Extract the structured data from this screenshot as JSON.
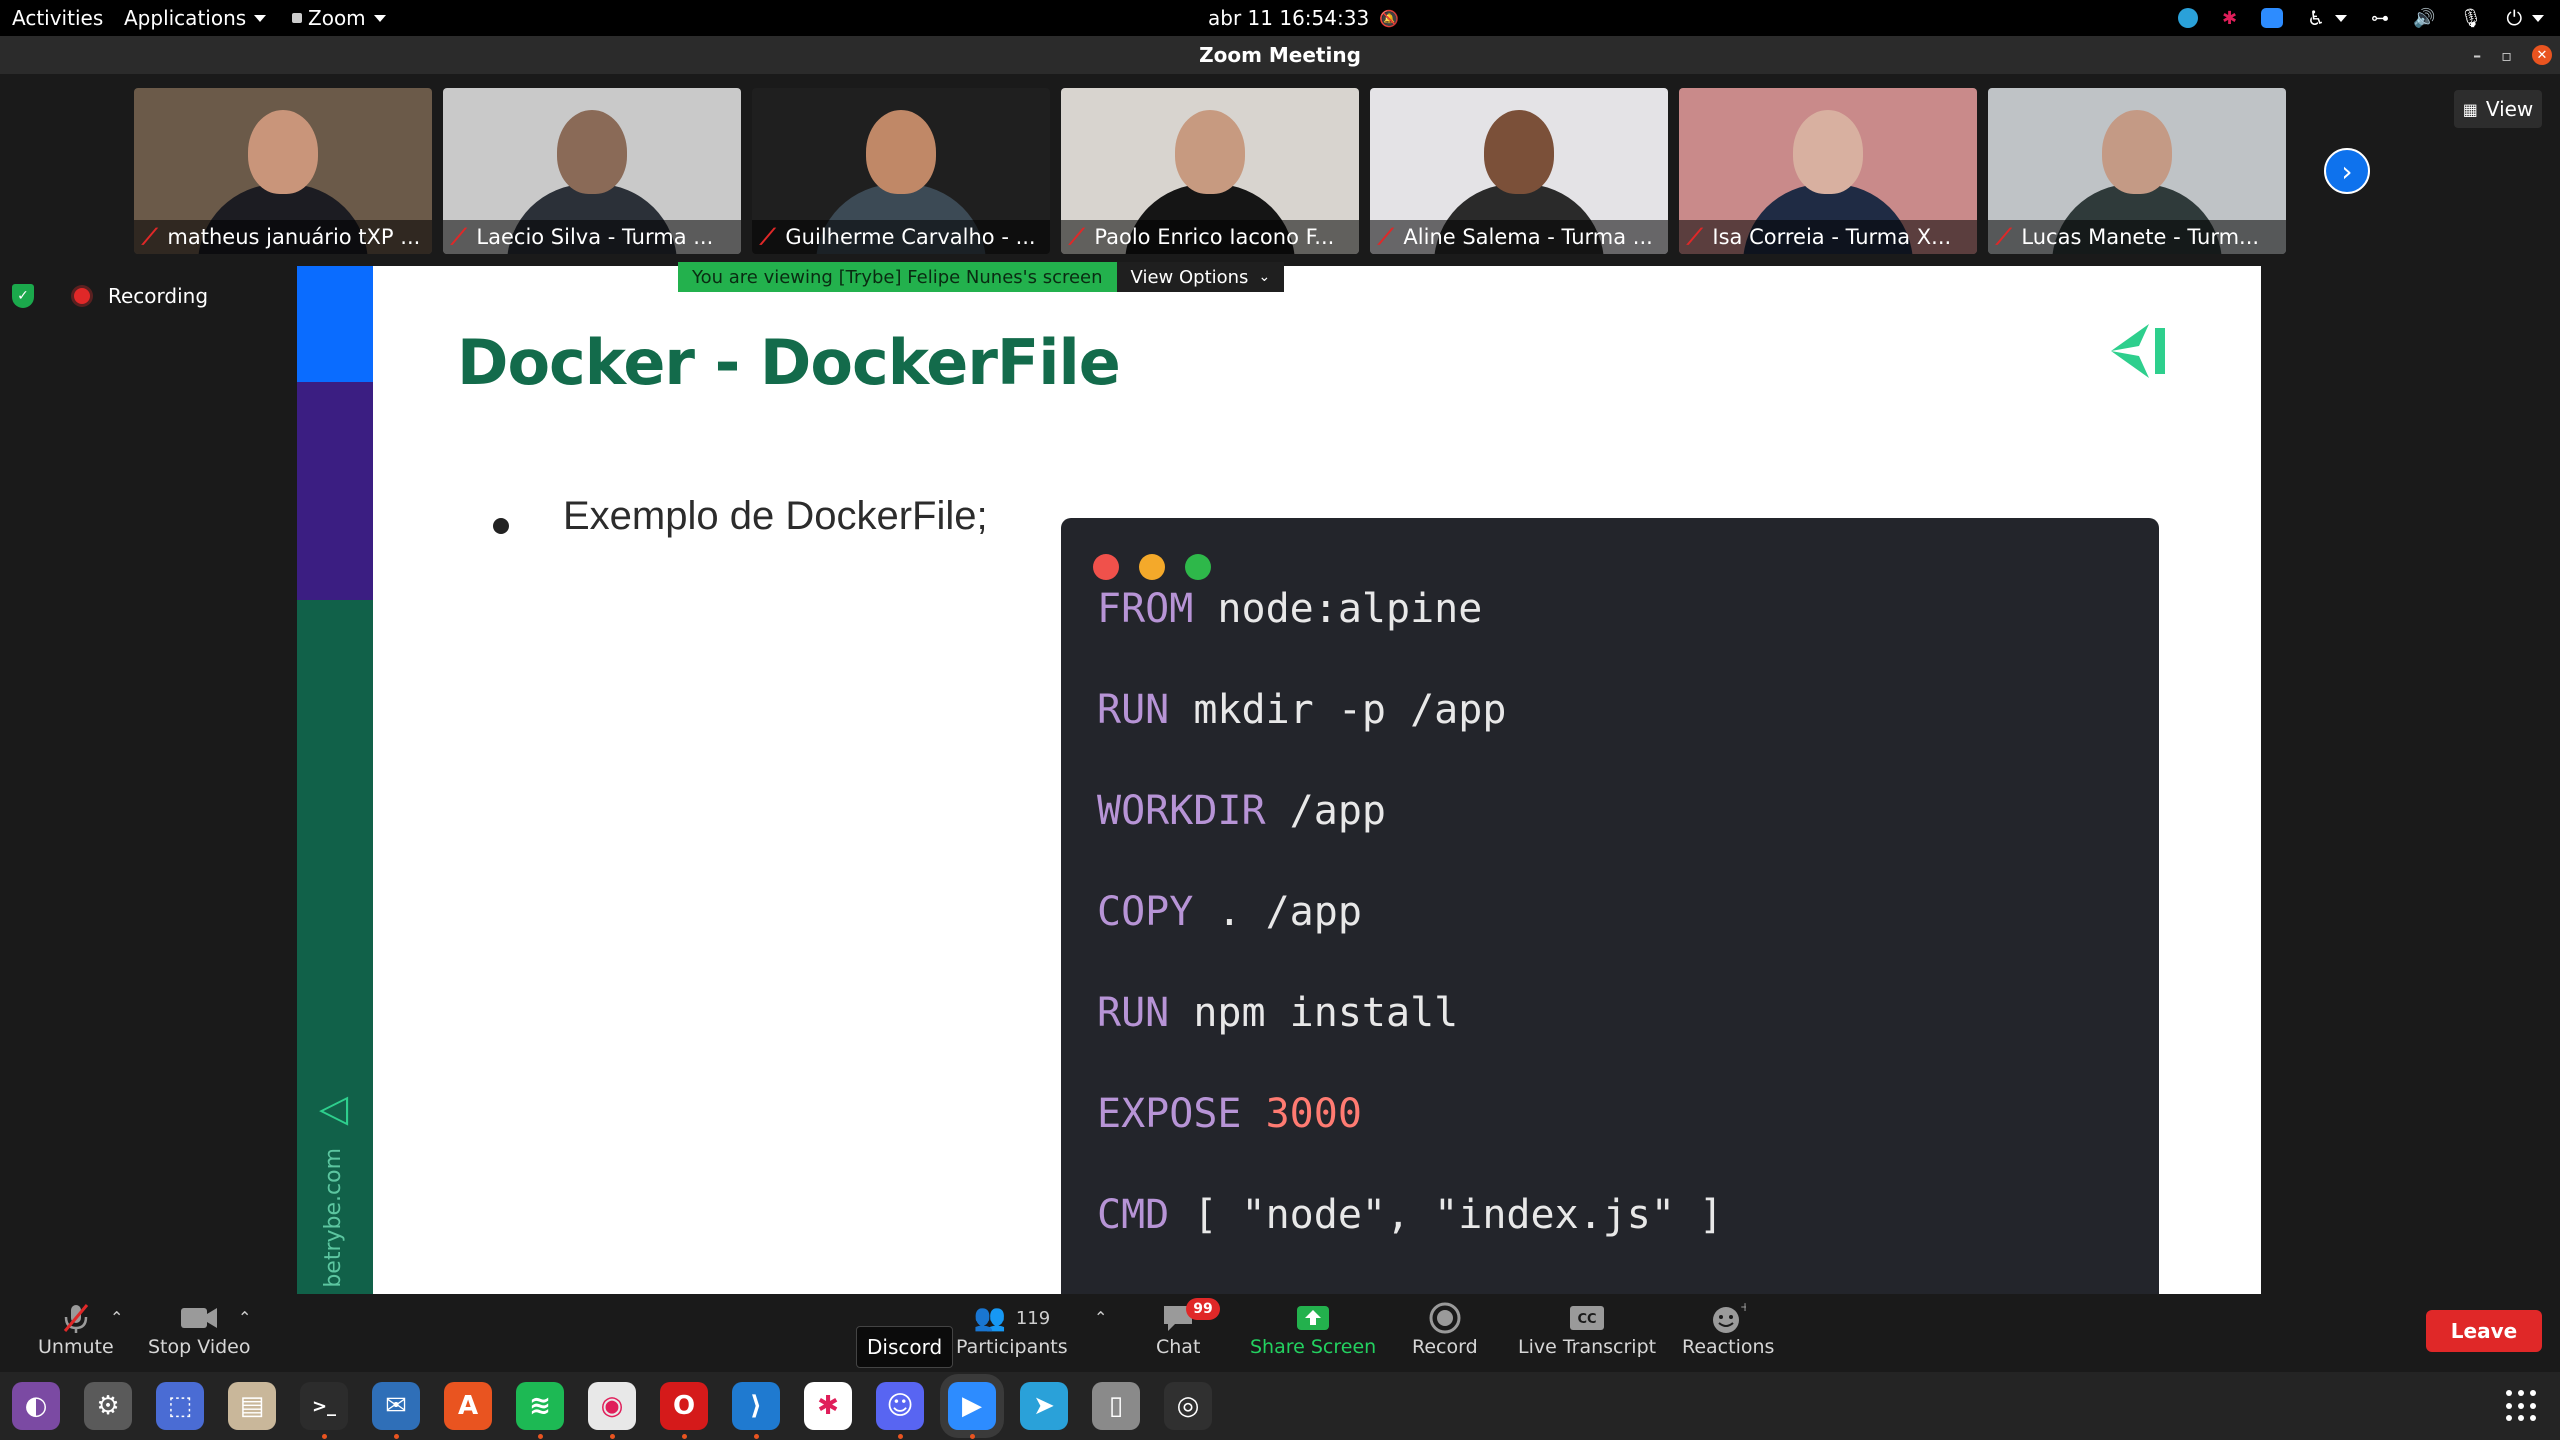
{
  "topbar": {
    "activities": "Activities",
    "applications": "Applications",
    "zoom_app": "Zoom",
    "datetime": "abr 11  16:54:33"
  },
  "window": {
    "title": "Zoom Meeting"
  },
  "participants_strip": [
    {
      "name": "matheus januário tXP ...",
      "bg": "#6b5a49",
      "skin": "#c9957a",
      "shirt": "#1c1c22"
    },
    {
      "name": "Laecio Silva - Turma ...",
      "bg": "#c9c9c9",
      "skin": "#8a6a57",
      "shirt": "#2b3038"
    },
    {
      "name": "Guilherme Carvalho - ...",
      "bg": "#1f1f1f",
      "skin": "#c08867",
      "shirt": "#3c4a55"
    },
    {
      "name": "Paolo Enrico Iacono F...",
      "bg": "#d8d4cf",
      "skin": "#c79a80",
      "shirt": "#151515"
    },
    {
      "name": "Aline Salema - Turma ...",
      "bg": "#e4e3e6",
      "skin": "#7b5039",
      "shirt": "#2a2a2a"
    },
    {
      "name": "Isa Correia - Turma X...",
      "bg": "#c98a8a",
      "skin": "#d8b0a0",
      "shirt": "#1f2b44"
    },
    {
      "name": "Lucas Manete - Turm...",
      "bg": "#bfc3c6",
      "skin": "#c49a85",
      "shirt": "#2f3a3a"
    }
  ],
  "view_button": "View",
  "recording_label": "Recording",
  "share_banner": {
    "viewing_text": "You are viewing [Trybe] Felipe Nunes's screen",
    "view_options": "View Options"
  },
  "slide": {
    "title": "Docker - DockerFile",
    "bullet": "Exemplo de DockerFile;",
    "side_text": "betrybe.com",
    "code": [
      {
        "kw": "FROM",
        "rest": " node:alpine"
      },
      {
        "kw": "RUN",
        "rest": " mkdir -p /app"
      },
      {
        "kw": "WORKDIR",
        "rest": " /app"
      },
      {
        "kw": "COPY",
        "rest": " . /app"
      },
      {
        "kw": "RUN",
        "rest": " npm install"
      },
      {
        "kw": "EXPOSE",
        "num": " 3000"
      },
      {
        "kw": "CMD",
        "rest": " [ \"node\", \"index.js\" ]"
      }
    ]
  },
  "zoom_controls": {
    "unmute": "Unmute",
    "stop_video": "Stop Video",
    "participants": "Participants",
    "participants_count": "119",
    "chat": "Chat",
    "chat_badge": "99",
    "share_screen": "Share Screen",
    "record": "Record",
    "live_transcript": "Live Transcript",
    "reactions": "Reactions",
    "leave": "Leave",
    "tooltip": "Discord"
  },
  "colors": {
    "accent_green": "#23b14d",
    "leave_red": "#e02828",
    "trybe_green": "#136b4b"
  },
  "dock": [
    {
      "icon": "toggle-app-icon",
      "bg": "#7b4aa3"
    },
    {
      "icon": "settings-icon",
      "bg": "#5a5a5a"
    },
    {
      "icon": "screenshot-tool-icon",
      "bg": "#4a6cd4"
    },
    {
      "icon": "files-icon",
      "bg": "#c9b79a"
    },
    {
      "icon": "terminal-icon",
      "bg": "#2c2c2c"
    },
    {
      "icon": "thunderbird-icon",
      "bg": "#2f6fb8"
    },
    {
      "icon": "app-store-icon",
      "bg": "#e95420"
    },
    {
      "icon": "spotify-icon",
      "bg": "#1db954"
    },
    {
      "icon": "chrome-icon",
      "bg": "#e8e8e8"
    },
    {
      "icon": "opera-icon",
      "bg": "#d51a1a"
    },
    {
      "icon": "vscode-icon",
      "bg": "#1f7ad0"
    },
    {
      "icon": "slack-icon",
      "bg": "#ffffff"
    },
    {
      "icon": "discord-icon",
      "bg": "#5865f2"
    },
    {
      "icon": "zoom-icon",
      "bg": "#2d8cff"
    },
    {
      "icon": "telegram-icon",
      "bg": "#2aa1d9"
    },
    {
      "icon": "trash-icon",
      "bg": "#8a8a8a"
    },
    {
      "icon": "camera-icon",
      "bg": "#303030"
    }
  ]
}
